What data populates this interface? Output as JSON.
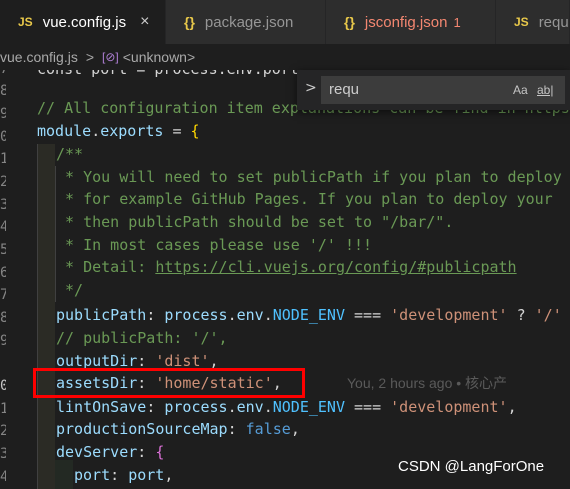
{
  "tabs": [
    {
      "icon": "JS",
      "label": "vue.config.js",
      "close": "×"
    },
    {
      "icon": "{}",
      "label": "package.json"
    },
    {
      "icon": "{}",
      "label": "jsconfig.json",
      "count": "1"
    },
    {
      "icon": "JS",
      "label": "requ"
    }
  ],
  "breadcrumb": {
    "file": "vue.config.js",
    "separator": ">",
    "symbol_icon": "[⊘]",
    "symbol": "<unknown>"
  },
  "find": {
    "chevron": ">",
    "query": "requ",
    "opt_case": "Aa",
    "opt_word": "ab|"
  },
  "gutter": [
    "7",
    "8",
    "9",
    "0",
    "1",
    "2",
    "3",
    "4",
    "5",
    "6",
    "7",
    "8",
    "9",
    "0",
    "1",
    "2",
    "3",
    "4"
  ],
  "code": {
    "l0": "const port = process.env.port",
    "l1_comment": "// All configuration item explanations can be find in https:",
    "l2_a": "module",
    "l2_b": ".",
    "l2_c": "exports",
    "l2_d": " = ",
    "l2_e": "{",
    "l3": "/**",
    "l4": " * You will need to set publicPath if you plan to deploy",
    "l5": " * for example GitHub Pages. If you plan to deploy your",
    "l6": " * then publicPath should be set to \"/bar/\".",
    "l7": " * In most cases please use '/' !!!",
    "l8_a": " * Detail: ",
    "l8_b": "https://cli.vuejs.org/config/#publicpath",
    "l9": " */",
    "l10_a": "publicPath",
    "l10_b": ": ",
    "l10_c": "process",
    "l10_d": ".",
    "l10_e": "env",
    "l10_f": ".",
    "l10_g": "NODE_ENV",
    "l10_h": " === ",
    "l10_i": "'development'",
    "l10_j": " ? ",
    "l10_k": "'/'",
    "l11": "// publicPath: '/',",
    "l12_a": "outputDir",
    "l12_b": ": ",
    "l12_c": "'dist'",
    "l12_d": ",",
    "l13_a": "assetsDir",
    "l13_b": ": ",
    "l13_c": "'home/static'",
    "l13_d": ",",
    "l13_blame": "You, 2 hours ago • 核心产",
    "l14_a": "lintOnSave",
    "l14_b": ": ",
    "l14_c": "process",
    "l14_d": ".",
    "l14_e": "env",
    "l14_f": ".",
    "l14_g": "NODE_ENV",
    "l14_h": " === ",
    "l14_i": "'development'",
    "l14_j": ",",
    "l15_a": "productionSourceMap",
    "l15_b": ": ",
    "l15_c": "false",
    "l15_d": ",",
    "l16_a": "devServer",
    "l16_b": ": ",
    "l16_c": "{",
    "l17_a": "port",
    "l17_b": ": ",
    "l17_c": "port",
    "l17_d": ","
  },
  "watermark": "CSDN @LangForOne",
  "colors": {
    "keyword": "#569cd6",
    "variable": "#9cdcfe",
    "string": "#ce9178",
    "comment": "#6a9955",
    "highlight": "#ff0000"
  }
}
